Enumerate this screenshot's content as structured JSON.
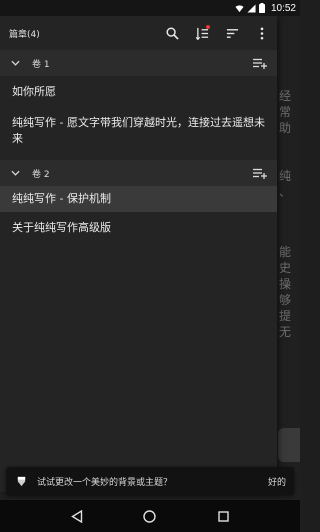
{
  "status_bar": {
    "time": "10:52"
  },
  "toolbar": {
    "title": "篇章(4)",
    "icons": [
      "search-icon",
      "sort-list-icon",
      "filter-icon",
      "more-vert-icon"
    ]
  },
  "volumes": [
    {
      "label": "卷 1",
      "chapters": [
        {
          "title": "如你所愿"
        },
        {
          "title": "纯纯写作 - 愿文字带我们穿越时光，连接过去遥想未来"
        }
      ]
    },
    {
      "label": "卷 2",
      "chapters": [
        {
          "title": "纯纯写作 - 保护机制"
        },
        {
          "title": "关于纯纯写作高级版"
        }
      ]
    }
  ],
  "editor_text": {
    "upper": [
      "经",
      "常",
      "助",
      "",
      "",
      "纯",
      "、"
    ],
    "lower": [
      "能",
      "史",
      "操",
      "够",
      "提",
      "无"
    ]
  },
  "snackbar": {
    "message": "试试更改一个美妙的背景或主题？",
    "action": "好的"
  },
  "colors": {
    "accent_dot": "#e53935",
    "selected_row": "#3a3a3a"
  }
}
